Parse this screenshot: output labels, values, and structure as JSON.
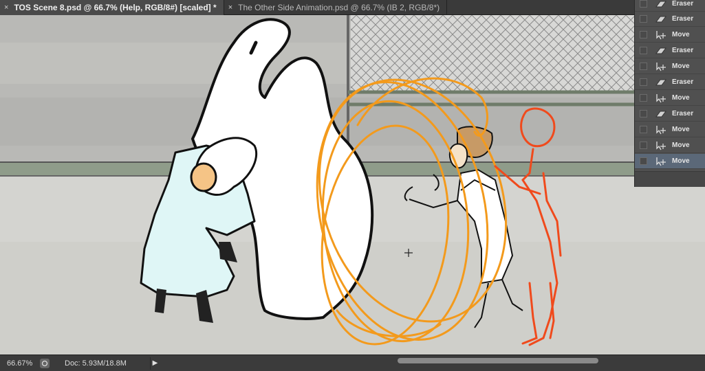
{
  "tabs": [
    {
      "title": "TOS Scene 8.psd @ 66.7% (Help, RGB/8#) [scaled] *",
      "close": "×",
      "active": true
    },
    {
      "title": "The Other Side Animation.psd @ 66.7% (IB 2, RGB/8*)",
      "close": "×",
      "active": false
    }
  ],
  "history": {
    "items": [
      {
        "label": "Eraser",
        "icon": "eraser-icon"
      },
      {
        "label": "Eraser",
        "icon": "eraser-icon"
      },
      {
        "label": "Move",
        "icon": "move-tool-icon"
      },
      {
        "label": "Eraser",
        "icon": "eraser-icon"
      },
      {
        "label": "Move",
        "icon": "move-tool-icon"
      },
      {
        "label": "Eraser",
        "icon": "eraser-icon"
      },
      {
        "label": "Move",
        "icon": "move-tool-icon"
      },
      {
        "label": "Eraser",
        "icon": "eraser-icon"
      },
      {
        "label": "Move",
        "icon": "move-tool-icon"
      },
      {
        "label": "Move",
        "icon": "move-tool-icon"
      },
      {
        "label": "Move",
        "icon": "move-tool-icon",
        "selected": true
      }
    ]
  },
  "status": {
    "zoom": "66.67%",
    "doc": "Doc: 5.93M/18.8M",
    "arrow": "▶"
  },
  "colors": {
    "sketch_orange": "#f39a1c",
    "sketch_red": "#f04a1c",
    "coat": "#dff6f6",
    "skin": "#f5c486",
    "hair": "#c79a66"
  }
}
